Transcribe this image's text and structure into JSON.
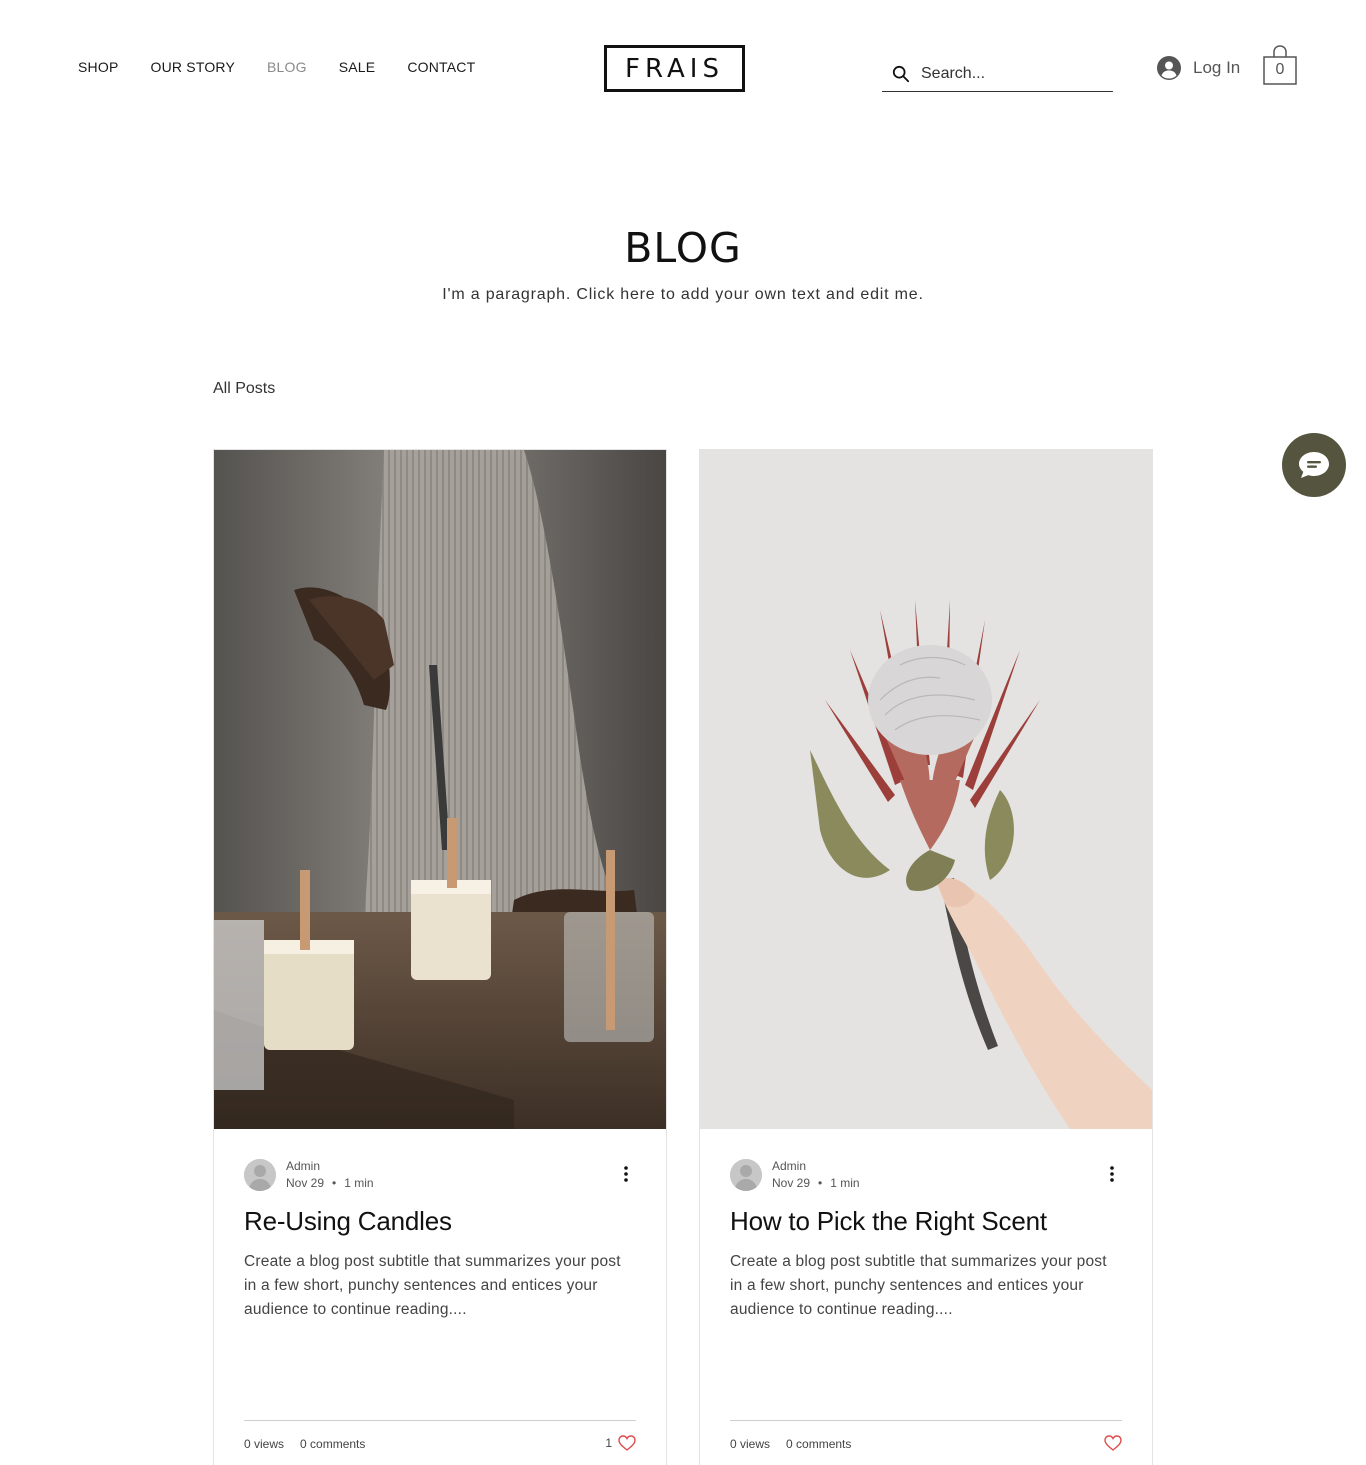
{
  "header": {
    "nav": [
      "SHOP",
      "OUR STORY",
      "BLOG",
      "SALE",
      "CONTACT"
    ],
    "active_nav": "BLOG",
    "logo": "FRAIS",
    "search_placeholder": "Search...",
    "login_label": "Log In",
    "cart_count": "0"
  },
  "blog": {
    "title": "BLOG",
    "paragraph": "I'm a paragraph. Click here to add your own text and edit me.",
    "filter_label": "All Posts"
  },
  "posts": [
    {
      "author": "Admin",
      "date": "Nov 29",
      "separator": "•",
      "read_time": "1 min",
      "title": "Re-Using Candles",
      "excerpt": "Create a blog post subtitle that summarizes your post in a few short, punchy sentences and entices your audience to continue reading....",
      "views": "0 views",
      "comments": "0 comments",
      "likes": "1",
      "image": "candle-making-photo"
    },
    {
      "author": "Admin",
      "date": "Nov 29",
      "separator": "•",
      "read_time": "1 min",
      "title": "How to Pick the Right Scent",
      "excerpt": "Create a blog post subtitle that summarizes your post in a few short, punchy sentences and entices your audience to continue reading....",
      "views": "0 views",
      "comments": "0 comments",
      "likes": "",
      "image": "protea-flower-photo"
    }
  ],
  "colors": {
    "accent_chat": "#55553f",
    "like_heart": "#e04b4b",
    "nav_active": "#8a8a8a"
  }
}
